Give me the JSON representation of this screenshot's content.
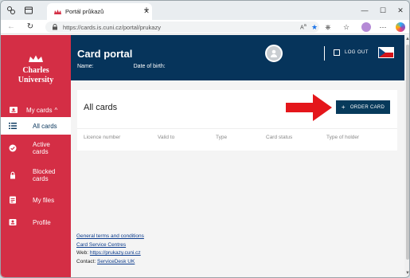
{
  "browser": {
    "tab_title": "Portál průkazů",
    "url": "https://cards.is.cuni.cz/portal/prukazy",
    "window_controls": [
      "minimize-icon",
      "maximize-icon",
      "close-icon"
    ]
  },
  "sidebar": {
    "brand_line1": "Charles",
    "brand_line2": "University",
    "group_label": "My cards",
    "items": [
      {
        "label": "All cards",
        "icon": "list-icon",
        "active": true
      },
      {
        "label": "Active cards",
        "icon": "check-circle-icon"
      },
      {
        "label": "Blocked cards",
        "icon": "lock-icon"
      },
      {
        "label": "My files",
        "icon": "document-icon"
      },
      {
        "label": "Profile",
        "icon": "profile-icon"
      }
    ]
  },
  "header": {
    "title": "Card portal",
    "name_label": "Name:",
    "dob_label": "Date of birth:",
    "logout_label": "LOG OUT"
  },
  "main": {
    "section_title": "All cards",
    "order_button": "ORDER CARD",
    "columns": [
      "Licence number",
      "Valid to",
      "Type",
      "Card status",
      "Type of holder"
    ]
  },
  "footer": {
    "terms": "General terms and conditions",
    "centres": "Card Service Centres",
    "web_label": "Web: ",
    "web_link": "https://prukazy.cuni.cz",
    "contact_label": "Contact: ",
    "contact_link": "ServiceDesk UK"
  },
  "colors": {
    "sidebar": "#d42e45",
    "header": "#06345b",
    "accent_arrow": "#e4161b"
  }
}
